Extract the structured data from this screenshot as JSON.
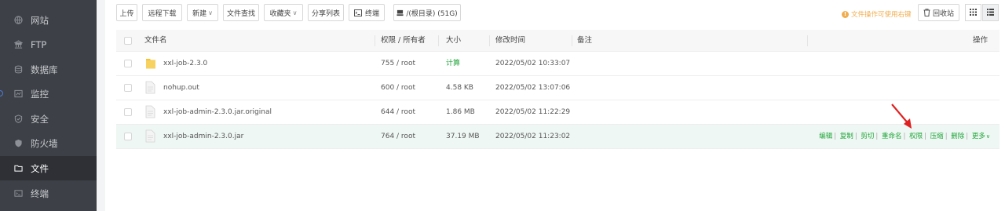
{
  "sidebar": {
    "items": [
      {
        "label": "网站",
        "icon": "globe-icon"
      },
      {
        "label": "FTP",
        "icon": "ftp-icon"
      },
      {
        "label": "数据库",
        "icon": "database-icon"
      },
      {
        "label": "监控",
        "icon": "monitor-icon"
      },
      {
        "label": "安全",
        "icon": "shield-icon"
      },
      {
        "label": "防火墙",
        "icon": "firewall-icon"
      },
      {
        "label": "文件",
        "icon": "folder-icon",
        "active": true
      },
      {
        "label": "终端",
        "icon": "terminal-icon"
      }
    ]
  },
  "toolbar": {
    "upload": "上传",
    "remote_download": "远程下载",
    "new": "新建",
    "file_search": "文件查找",
    "favorites": "收藏夹",
    "share_list": "分享列表",
    "terminal": "终端",
    "disk": "/(根目录) (51G)",
    "note": "文件操作可使用右键",
    "recycle_bin": "回收站"
  },
  "table": {
    "headers": {
      "name": "文件名",
      "perm": "权限 / 所有者",
      "size": "大小",
      "mtime": "修改时间",
      "remark": "备注",
      "ops": "操作"
    },
    "rows": [
      {
        "name": "xxl-job-2.3.0",
        "type": "folder",
        "perm": "755 / root",
        "size": "计算",
        "mtime": "2022/05/02 10:33:07"
      },
      {
        "name": "nohup.out",
        "type": "file",
        "perm": "600 / root",
        "size": "4.58 KB",
        "mtime": "2022/05/02 13:07:06"
      },
      {
        "name": "xxl-job-admin-2.3.0.jar.original",
        "type": "file",
        "perm": "644 / root",
        "size": "1.86 MB",
        "mtime": "2022/05/02 11:22:29"
      },
      {
        "name": "xxl-job-admin-2.3.0.jar",
        "type": "file",
        "perm": "764 / root",
        "size": "37.19 MB",
        "mtime": "2022/05/02 11:23:02",
        "highlighted": true
      }
    ],
    "row_actions": [
      "编辑",
      "复制",
      "剪切",
      "重命名",
      "权限",
      "压缩",
      "删除",
      "更多"
    ]
  },
  "colors": {
    "sidebar_bg": "#3d4046",
    "accent_green": "#20a53a",
    "warning": "#f0ad4e",
    "annotation_arrow": "#e02020"
  }
}
